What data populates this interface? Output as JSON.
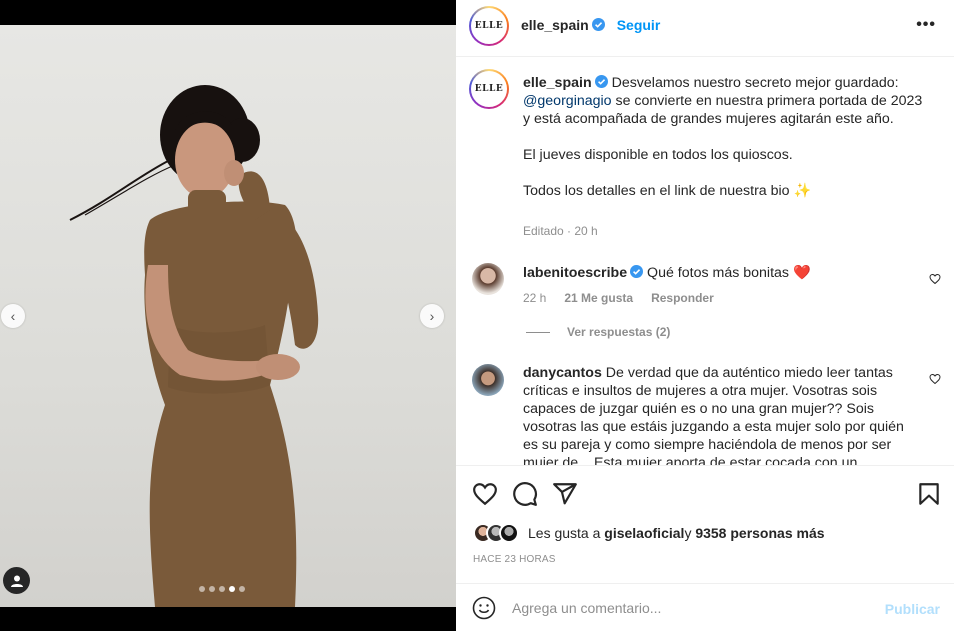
{
  "post": {
    "username": "elle_spain",
    "follow_label": "Seguir",
    "more_label": "•••",
    "avatar_logo": "ELLE",
    "media": {
      "slides_total": 5,
      "active_slide": 4
    }
  },
  "caption": {
    "username": "elle_spain",
    "text_before_mention": "Desvelamos nuestro secreto mejor guardado:",
    "mention": "@georginagio",
    "text_after_mention": " se convierte en nuestra primera portada de 2023 y está acompañada de grandes mujeres agitarán este año.",
    "paragraph2": "El jueves disponible en todos los quioscos.",
    "paragraph3": "Todos los detalles en el link de nuestra bio ✨",
    "meta": "Editado · 20 h"
  },
  "comments": [
    {
      "username": "labenitoescribe",
      "verified": true,
      "text": "Qué fotos más bonitas ❤️",
      "time": "22 h",
      "likes": "21 Me gusta",
      "reply_label": "Responder",
      "view_replies": "Ver respuestas (2)"
    },
    {
      "username": "danycantos",
      "verified": false,
      "text": "De verdad que da auténtico miedo leer tantas críticas e insultos de mujeres a otra mujer. Vosotras sois capaces de juzgar quién es o no una gran mujer?? Sois vosotras las que estáis juzgando a esta mujer solo por quién es su pareja y como siempre haciéndola de menos por ser mujer de... Esta mujer aporta de estar cocada con un..."
    }
  ],
  "likes": {
    "prefix": "Les gusta a ",
    "user": "giselaoficial",
    "connector": " y ",
    "count": "9358 personas más"
  },
  "timestamp": "HACE 23 HORAS",
  "add_comment": {
    "placeholder": "Agrega un comentario...",
    "publish_label": "Publicar"
  },
  "colors": {
    "accent": "#0095f6",
    "publish_disabled": "#b2dffc",
    "verified": "#3897f0",
    "heart_red": "#ed4956"
  }
}
